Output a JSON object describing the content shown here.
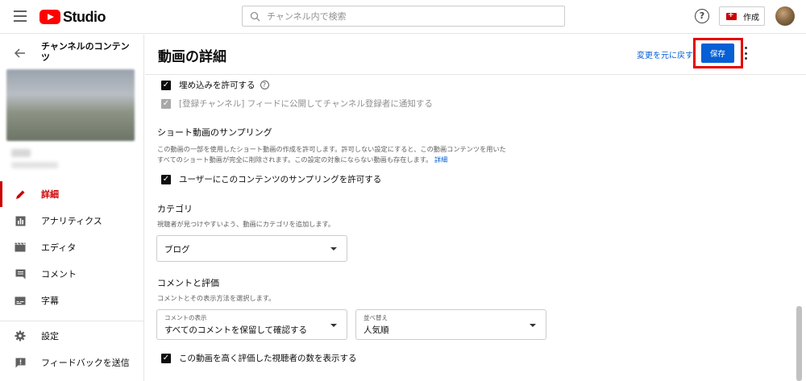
{
  "app": {
    "logo_text": "Studio",
    "brand_color": "#ff0000",
    "accent_color": "#065fd4"
  },
  "search": {
    "placeholder": "チャンネル内で検索"
  },
  "header": {
    "help_label": "?",
    "create_label": "作成"
  },
  "sidebar": {
    "title": "チャンネルのコンテンツ",
    "items": [
      {
        "label": "詳細",
        "icon": "pencil-icon",
        "active": true
      },
      {
        "label": "アナリティクス",
        "icon": "analytics-icon",
        "active": false
      },
      {
        "label": "エディタ",
        "icon": "editor-icon",
        "active": false
      },
      {
        "label": "コメント",
        "icon": "comment-icon",
        "active": false
      },
      {
        "label": "字幕",
        "icon": "subtitles-icon",
        "active": false
      },
      {
        "label": "設定",
        "icon": "gear-icon",
        "active": false
      },
      {
        "label": "フィードバックを送信",
        "icon": "feedback-icon",
        "active": false
      }
    ]
  },
  "main": {
    "title": "動画の詳細",
    "undo_label": "変更を元に戻す",
    "save_label": "保存"
  },
  "options": {
    "embed": {
      "label": "埋め込みを許可する",
      "checked": true,
      "help": "?"
    },
    "notify": {
      "label": "[登録チャンネル] フィードに公開してチャンネル登録者に通知する",
      "checked": true,
      "disabled": true
    }
  },
  "shorts": {
    "title": "ショート動画のサンプリング",
    "desc_line1": "この動画の一部を使用したショート動画の作成を許可します。許可しない設定にすると、この動画コンテンツを用いた",
    "desc_line2": "すべてのショート動画が完全に削除されます。この設定の対象にならない動画も存在します。",
    "details_link": "詳細",
    "checkbox_label": "ユーザーにこのコンテンツのサンプリングを許可する"
  },
  "category": {
    "title": "カテゴリ",
    "desc": "視聴者が見つけやすいよう、動画にカテゴリを追加します。",
    "value": "ブログ"
  },
  "comments": {
    "title": "コメントと評価",
    "desc": "コメントとその表示方法を選択します。",
    "visibility_label": "コメントの表示",
    "visibility_value": "すべてのコメントを保留して確認する",
    "sort_label": "並べ替え",
    "sort_value": "人気順",
    "likes_label": "この動画を高く評価した視聴者の数を表示する"
  }
}
